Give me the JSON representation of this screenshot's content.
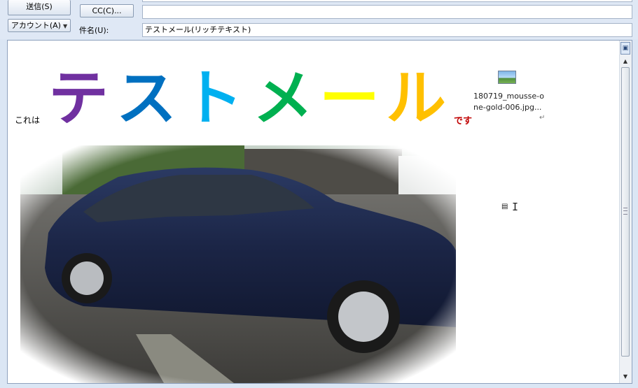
{
  "header": {
    "send_label": "送信(S)",
    "account_label": "アカウント(A)",
    "cc_label": "CC(C)...",
    "cc_value": "",
    "subject_label": "件名(U):",
    "subject_value": "テストメール(リッチテキスト)"
  },
  "body": {
    "intro_text": "これは",
    "big_chars": [
      {
        "char": "テ",
        "color": "#7030a0"
      },
      {
        "char": "ス",
        "color": "#0070c0"
      },
      {
        "char": "ト",
        "color": "#00b0f0"
      },
      {
        "char": "メ",
        "color": "#00b050"
      },
      {
        "char": "ー",
        "color": "#ffff00"
      },
      {
        "char": "ル",
        "color": "#ffc000"
      }
    ],
    "suffix_text": "です",
    "suffix_color": "#c00000",
    "attachment_name": "180719_mousse-one-gold-006.jpg...",
    "attachment_icon": "image-file-icon",
    "photo_subject": "car-photo"
  },
  "colors": {
    "window_bg": "#dbe6f4",
    "border": "#8ea1bd"
  }
}
